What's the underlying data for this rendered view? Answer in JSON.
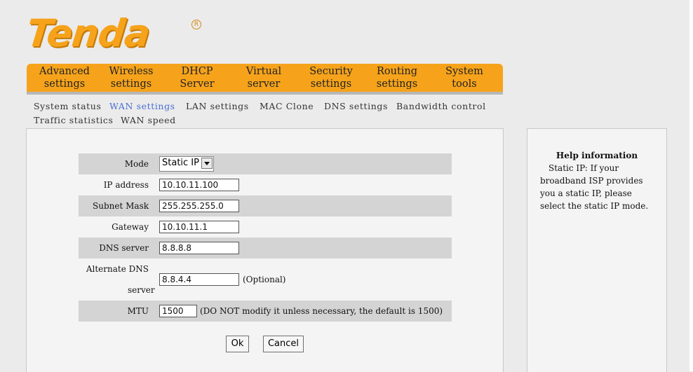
{
  "brand": {
    "logo_text": "Tenda",
    "reg_mark": "R"
  },
  "main_nav": [
    {
      "label": "Advanced\nsettings"
    },
    {
      "label": "Wireless\nsettings"
    },
    {
      "label": "DHCP\nServer"
    },
    {
      "label": "Virtual\nserver"
    },
    {
      "label": "Security\nsettings"
    },
    {
      "label": "Routing\nsettings"
    },
    {
      "label": "System\ntools"
    }
  ],
  "sub_nav": [
    {
      "label": "System status"
    },
    {
      "label": "WAN settings",
      "active": true
    },
    {
      "label": "LAN settings"
    },
    {
      "label": "MAC Clone"
    },
    {
      "label": "DNS settings"
    },
    {
      "label": "Bandwidth control"
    },
    {
      "label": "Traffic statistics"
    },
    {
      "label": "WAN speed"
    }
  ],
  "form": {
    "mode": {
      "label": "Mode",
      "value": "Static IP"
    },
    "ip": {
      "label": "IP address",
      "value": "10.10.11.100"
    },
    "mask": {
      "label": "Subnet Mask",
      "value": "255.255.255.0"
    },
    "gateway": {
      "label": "Gateway",
      "value": "10.10.11.1"
    },
    "dns": {
      "label": "DNS server",
      "value": "8.8.8.8"
    },
    "alt_dns": {
      "label_line1": "Alternate DNS",
      "label_line2": "server",
      "value": "8.8.4.4",
      "note": "(Optional)"
    },
    "mtu": {
      "label": "MTU",
      "value": "1500",
      "note": "(DO NOT modify it unless necessary, the default is 1500)"
    }
  },
  "buttons": {
    "ok": "Ok",
    "cancel": "Cancel"
  },
  "help": {
    "title": "Help information",
    "text": "Static IP: If your broadband ISP provides you a static IP, please select the static IP mode."
  },
  "colors": {
    "accent": "#f6a31b",
    "link_active": "#4a6fd4",
    "row_shade": "#d4d4d4"
  }
}
